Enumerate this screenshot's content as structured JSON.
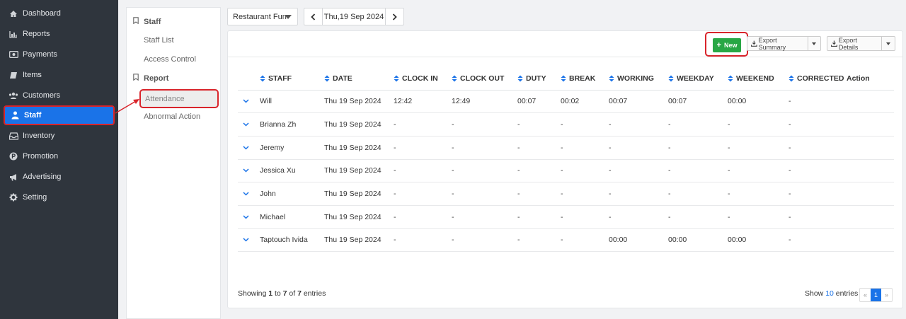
{
  "sidebar": {
    "items": [
      {
        "label": "Dashboard",
        "icon": "dashboard-icon"
      },
      {
        "label": "Reports",
        "icon": "bar-chart-icon"
      },
      {
        "label": "Payments",
        "icon": "money-icon"
      },
      {
        "label": "Items",
        "icon": "book-icon"
      },
      {
        "label": "Customers",
        "icon": "users-icon"
      },
      {
        "label": "Staff",
        "icon": "staff-icon",
        "active": true
      },
      {
        "label": "Inventory",
        "icon": "inbox-icon"
      },
      {
        "label": "Promotion",
        "icon": "promotion-icon"
      },
      {
        "label": "Advertising",
        "icon": "megaphone-icon"
      },
      {
        "label": "Setting",
        "icon": "gear-icon"
      }
    ]
  },
  "submenu": {
    "staff_heading": "Staff",
    "staff_list": "Staff List",
    "access_control": "Access Control",
    "report_heading": "Report",
    "attendance": "Attendance",
    "abnormal_action": "Abnormal Action"
  },
  "filter": {
    "restaurant": "Restaurant Fun",
    "date": "Thu,19 Sep 2024"
  },
  "toolbar": {
    "new_label": "New",
    "export_summary_label": "Export Summary",
    "export_details_label": "Export Details"
  },
  "table": {
    "headers": [
      "STAFF",
      "DATE",
      "CLOCK IN",
      "CLOCK OUT",
      "DUTY",
      "BREAK",
      "WORKING",
      "WEEKDAY",
      "WEEKEND",
      "CORRECTED",
      "Action"
    ],
    "rows": [
      [
        "Will",
        "Thu 19 Sep 2024",
        "12:42",
        "12:49",
        "00:07",
        "00:02",
        "00:07",
        "00:07",
        "00:00",
        "-",
        ""
      ],
      [
        "Brianna Zh",
        "Thu 19 Sep 2024",
        "-",
        "-",
        "-",
        "-",
        "-",
        "-",
        "-",
        "-",
        ""
      ],
      [
        "Jeremy",
        "Thu 19 Sep 2024",
        "-",
        "-",
        "-",
        "-",
        "-",
        "-",
        "-",
        "-",
        ""
      ],
      [
        "Jessica Xu",
        "Thu 19 Sep 2024",
        "-",
        "-",
        "-",
        "-",
        "-",
        "-",
        "-",
        "-",
        ""
      ],
      [
        "John",
        "Thu 19 Sep 2024",
        "-",
        "-",
        "-",
        "-",
        "-",
        "-",
        "-",
        "-",
        ""
      ],
      [
        "Michael",
        "Thu 19 Sep 2024",
        "-",
        "-",
        "-",
        "-",
        "-",
        "-",
        "-",
        "-",
        ""
      ],
      [
        "Taptouch Ivida",
        "Thu 19 Sep 2024",
        "-",
        "-",
        "-",
        "-",
        "00:00",
        "00:00",
        "00:00",
        "-",
        ""
      ]
    ]
  },
  "footer": {
    "showing_prefix": "Showing ",
    "from": "1",
    "to_word": " to ",
    "to": "7",
    "of_word": " of ",
    "total": "7",
    "entries_word": " entries",
    "show_label": "Show ",
    "page_size": "10",
    "show_suffix": " entries",
    "prev": "«",
    "page": "1",
    "next": "»"
  },
  "colors": {
    "sidebar_bg": "#2f353d",
    "accent": "#1a73e8",
    "new_button": "#28a745",
    "highlight": "#d9242b"
  }
}
